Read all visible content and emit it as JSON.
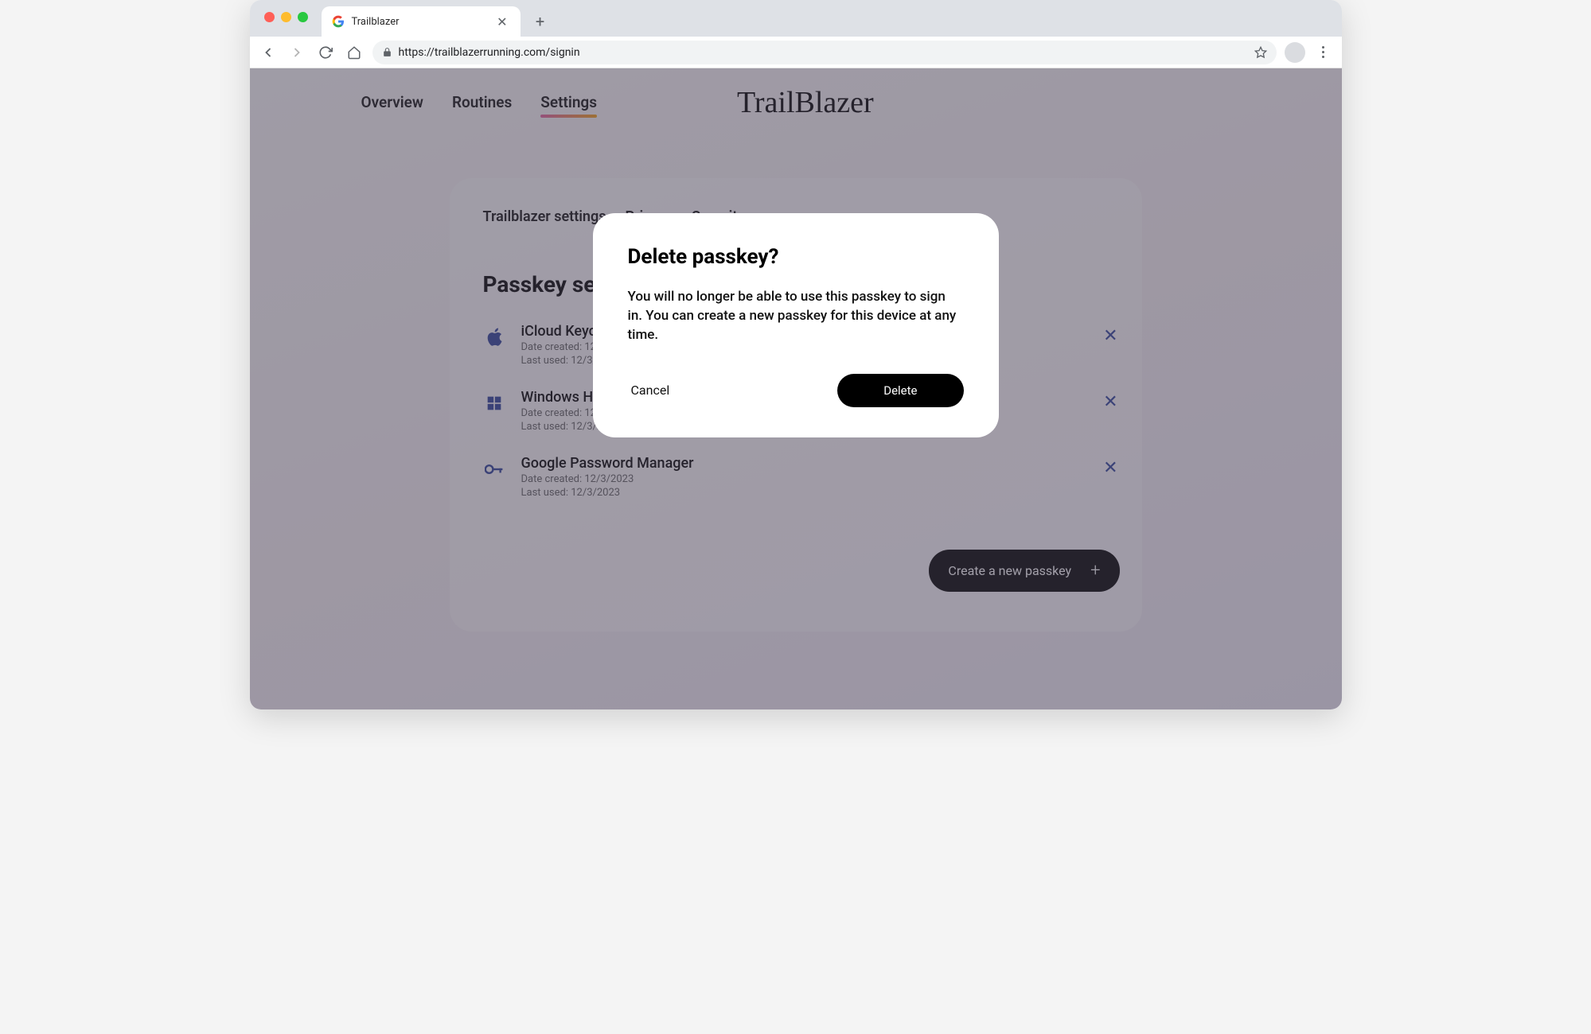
{
  "browser": {
    "tab_title": "Trailblazer",
    "url": "https://trailblazerrunning.com/signin"
  },
  "brand": "TrailBlazer",
  "main_nav": {
    "items": [
      "Overview",
      "Routines",
      "Settings"
    ],
    "active_index": 2
  },
  "sub_nav": {
    "items": [
      "Trailblazer settings",
      "Privacy",
      "Security"
    ],
    "active_index": 2
  },
  "section_title": "Passkey settings",
  "passkeys": [
    {
      "name": "iCloud Keychain",
      "created": "Date created: 12/3/2023",
      "last_used": "Last used: 12/3/2023"
    },
    {
      "name": "Windows Hello",
      "created": "Date created: 12/3/2023",
      "last_used": "Last used: 12/3/2023"
    },
    {
      "name": "Google Password Manager",
      "created": "Date created: 12/3/2023",
      "last_used": "Last used: 12/3/2023"
    }
  ],
  "create_button": "Create a new passkey",
  "modal": {
    "title": "Delete passkey?",
    "body": "You will no longer be able to use this passkey to sign in. You can create a new passkey for this device at any time.",
    "cancel": "Cancel",
    "confirm": "Delete"
  }
}
